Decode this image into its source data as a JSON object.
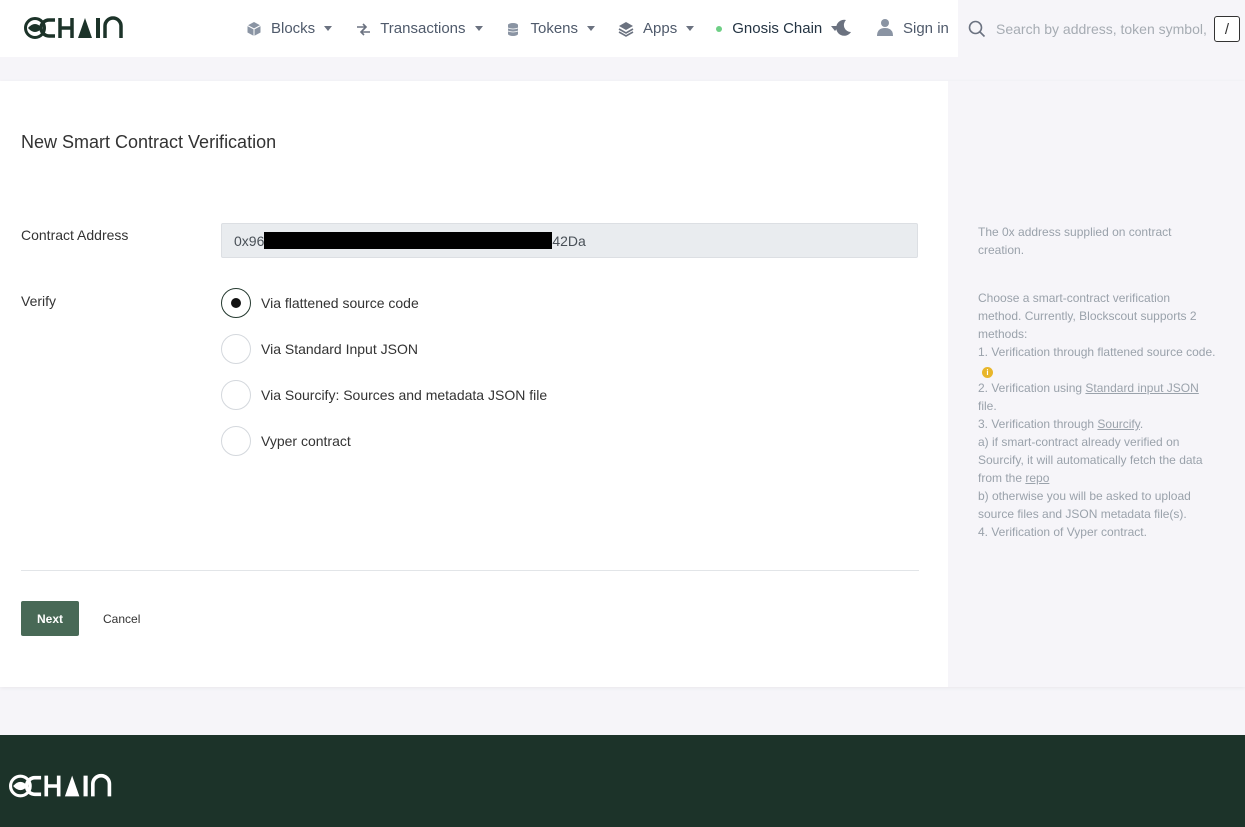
{
  "header": {
    "logo_text": "CHAIN",
    "nav": [
      {
        "label": "Blocks",
        "icon": "cube-icon"
      },
      {
        "label": "Transactions",
        "icon": "arrows-swap-icon"
      },
      {
        "label": "Tokens",
        "icon": "coins-stack-icon"
      },
      {
        "label": "Apps",
        "icon": "layers-icon"
      }
    ],
    "network": {
      "label": "Gnosis Chain",
      "status_color": "#6ecf85"
    },
    "theme_icon": "moon-icon",
    "sign_in": "Sign in",
    "search": {
      "placeholder": "Search by address, token symbol, name, transaction hash, or block number",
      "shortcut": "/"
    }
  },
  "form": {
    "title": "New Smart Contract Verification",
    "address_label": "Contract Address",
    "address_prefix": "0x96",
    "address_suffix": "42Da",
    "verify_label": "Verify",
    "options": [
      {
        "label": "Via flattened source code",
        "checked": true
      },
      {
        "label": "Via Standard Input JSON",
        "checked": false
      },
      {
        "label": "Via Sourcify: Sources and metadata JSON file",
        "checked": false
      },
      {
        "label": "Vyper contract",
        "checked": false
      }
    ],
    "next_label": "Next",
    "cancel_label": "Cancel"
  },
  "help": {
    "address_help": "The 0x address supplied on contract creation.",
    "verify_intro": "Choose a smart-contract verification method. Currently, Blockscout supports 2 methods:",
    "item1": "1. Verification through flattened source code.",
    "item2_pre": "2. Verification using ",
    "item2_link": "Standard input JSON",
    "item2_post": " file.",
    "item3_pre": "3. Verification through ",
    "item3_link": "Sourcify",
    "item3_post": ".",
    "item3a_pre": "a) if smart-contract already verified on Sourcify, it will automatically fetch the data from the ",
    "item3a_link": "repo",
    "item3b": "b) otherwise you will be asked to upload source files and JSON metadata file(s).",
    "item4": "4. Verification of Vyper contract.",
    "info_glyph": "i"
  },
  "colors": {
    "accent": "#486956",
    "footer_bg": "#1c3329"
  }
}
